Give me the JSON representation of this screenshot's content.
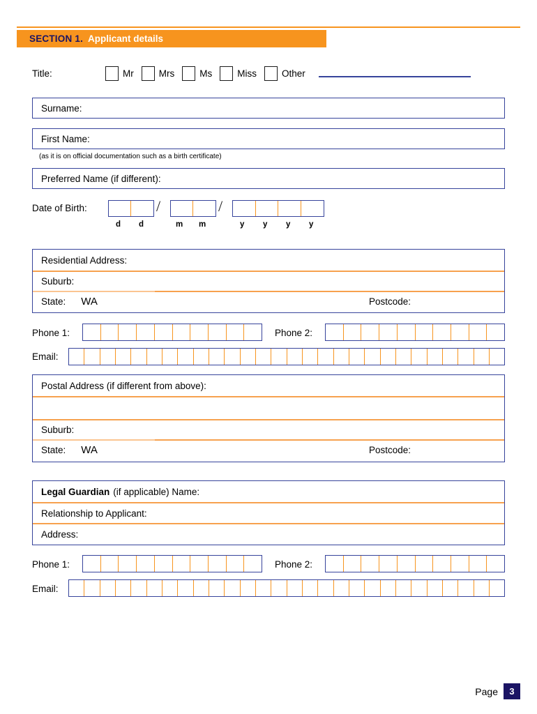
{
  "section": {
    "number": "SECTION 1.",
    "title": "Applicant details"
  },
  "title_row": {
    "label": "Title:",
    "options": [
      "Mr",
      "Mrs",
      "Ms",
      "Miss",
      "Other"
    ],
    "other_value": ""
  },
  "fields": {
    "surname_label": "Surname:",
    "surname_value": "",
    "first_name_label": "First Name:",
    "first_name_value": "",
    "first_name_note": "(as it is on official documentation such as a birth certificate)",
    "preferred_name_label": "Preferred Name (if different):",
    "preferred_name_value": ""
  },
  "dob": {
    "label": "Date of Birth:",
    "separator": "/",
    "day_hint_1": "d",
    "day_hint_2": "d",
    "month_hint_1": "m",
    "month_hint_2": "m",
    "year_hint_1": "y",
    "year_hint_2": "y",
    "year_hint_3": "y",
    "year_hint_4": "y",
    "day_cells": 2,
    "month_cells": 2,
    "year_cells": 4,
    "value": ""
  },
  "residential": {
    "address_label": "Residential Address:",
    "address_value": "",
    "suburb_label": "Suburb:",
    "suburb_value": "",
    "state_label": "State:",
    "state_value": "WA",
    "postcode_label": "Postcode:",
    "postcode_value": ""
  },
  "contact_applicant": {
    "phone1_label": "Phone 1:",
    "phone1_cells": 10,
    "phone1_value": "",
    "phone2_label": "Phone 2:",
    "phone2_cells": 10,
    "phone2_value": "",
    "email_label": "Email:",
    "email_cells": 28,
    "email_value": ""
  },
  "postal": {
    "address_label": "Postal Address (if different from above):",
    "address_value": "",
    "address_line2_value": "",
    "suburb_label": "Suburb:",
    "suburb_value": "",
    "state_label": "State:",
    "state_value": "WA",
    "postcode_label": "Postcode:",
    "postcode_value": ""
  },
  "guardian": {
    "name_label_bold": "Legal Guardian",
    "name_label_rest": "(if applicable) Name:",
    "name_value": "",
    "relationship_label": "Relationship to Applicant:",
    "relationship_value": "",
    "address_label": "Address:",
    "address_value": ""
  },
  "contact_guardian": {
    "phone1_label": "Phone 1:",
    "phone1_cells": 10,
    "phone1_value": "",
    "phone2_label": "Phone 2:",
    "phone2_cells": 10,
    "phone2_value": "",
    "email_label": "Email:",
    "email_cells": 28,
    "email_value": ""
  },
  "footer": {
    "page_label": "Page",
    "page_number": "3"
  },
  "colors": {
    "orange": "#F7941E",
    "orange_rule": "#F7A14E",
    "navy_border": "#36439b",
    "navy_dark": "#1B1464"
  }
}
